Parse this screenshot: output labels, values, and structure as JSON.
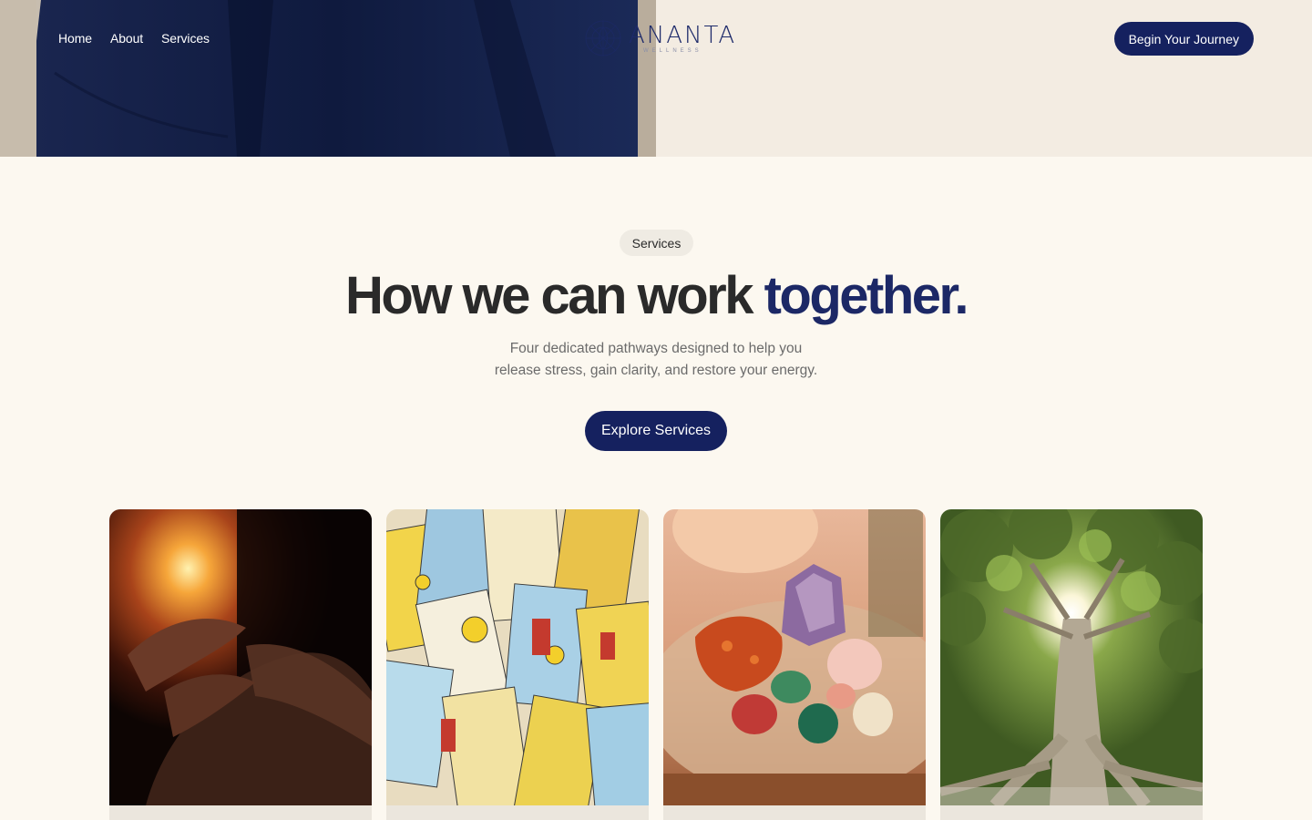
{
  "brand": {
    "name": "ANANTA",
    "tagline": "WELLNESS",
    "primary_color": "#15215f",
    "accent_color": "#1c2866",
    "background": "#fcf8f0"
  },
  "nav": {
    "items": [
      {
        "label": "Home"
      },
      {
        "label": "About"
      },
      {
        "label": "Services"
      }
    ],
    "cta_label": "Begin Your Journey"
  },
  "services": {
    "badge": "Services",
    "headline_main": "How we can work ",
    "headline_accent": "together.",
    "subtitle_line1": "Four dedicated pathways designed to help you",
    "subtitle_line2": "release stress, gain clarity, and restore your energy.",
    "cta_label": "Explore Services",
    "cards": [
      {
        "image": "candle-face-massage-photo"
      },
      {
        "image": "tarot-cards-photo"
      },
      {
        "image": "healing-crystals-photo"
      },
      {
        "image": "sunlit-tree-photo"
      }
    ]
  }
}
